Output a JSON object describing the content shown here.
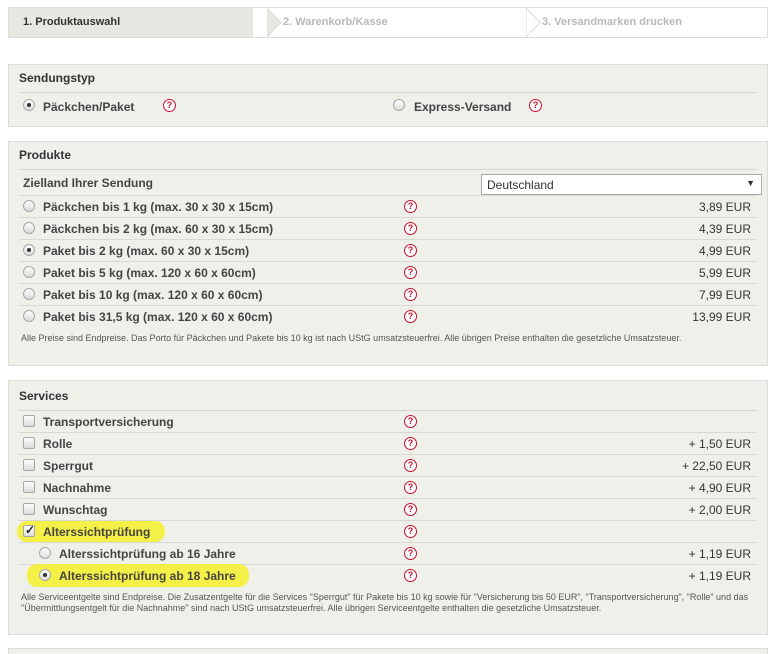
{
  "steps": [
    {
      "label": "1. Produktauswahl"
    },
    {
      "label": "2. Warenkorb/Kasse"
    },
    {
      "label": "3. Versandmarken drucken"
    }
  ],
  "sendungstyp": {
    "title": "Sendungstyp",
    "options": [
      {
        "label": "Päckchen/Paket",
        "selected": true
      },
      {
        "label": "Express-Versand",
        "selected": false
      }
    ]
  },
  "produkte": {
    "title": "Produkte",
    "zielland_label": "Zielland Ihrer Sendung",
    "zielland_value": "Deutschland",
    "items": [
      {
        "label": "Päckchen bis 1 kg (max. 30 x 30 x 15cm)",
        "price": "3,89 EUR",
        "selected": false
      },
      {
        "label": "Päckchen bis 2 kg (max. 60 x 30 x 15cm)",
        "price": "4,39 EUR",
        "selected": false
      },
      {
        "label": "Paket bis 2 kg (max. 60 x 30 x 15cm)",
        "price": "4,99 EUR",
        "selected": true
      },
      {
        "label": "Paket bis 5 kg (max. 120 x 60 x 60cm)",
        "price": "5,99 EUR",
        "selected": false
      },
      {
        "label": "Paket bis 10 kg (max. 120 x 60 x 60cm)",
        "price": "7,99 EUR",
        "selected": false
      },
      {
        "label": "Paket bis 31,5 kg (max. 120 x 60 x 60cm)",
        "price": "13,99 EUR",
        "selected": false
      }
    ],
    "note": "Alle Preise sind Endpreise. Das Porto für Päckchen und Pakete bis 10 kg ist nach UStG umsatzsteuerfrei. Alle übrigen Preise enthalten die gesetzliche Umsatzsteuer."
  },
  "services": {
    "title": "Services",
    "items": [
      {
        "label": "Transportversicherung",
        "price": "",
        "checked": false
      },
      {
        "label": "Rolle",
        "price": "+ 1,50 EUR",
        "checked": false
      },
      {
        "label": "Sperrgut",
        "price": "+ 22,50 EUR",
        "checked": false
      },
      {
        "label": "Nachnahme",
        "price": "+ 4,90 EUR",
        "checked": false
      },
      {
        "label": "Wunschtag",
        "price": "+ 2,00 EUR",
        "checked": false
      },
      {
        "label": "Alterssichtprüfung",
        "price": "",
        "checked": true
      }
    ],
    "sub_items": [
      {
        "label": "Alterssichtprüfung ab 16 Jahre",
        "price": "+ 1,19 EUR",
        "selected": false
      },
      {
        "label": "Alterssichtprüfung ab 18 Jahre",
        "price": "+ 1,19 EUR",
        "selected": true
      }
    ],
    "note": "Alle Serviceentgelte sind Endpreise. Die Zusatzentgelte für die Services \"Sperrgut\" für Pakete bis 10 kg sowie für \"Versicherung bis 50 EUR\", \"Transportversicherung\", \"Rolle\" und das \"Übermittlungsentgelt für die Nachnahme\" sind nach UStG umsatzsteuerfrei. Alle übrigen Serviceentgelte enthalten die gesetzliche Umsatzsteuer."
  },
  "help_symbol": "?",
  "colors": {
    "help": "#c8102e",
    "highlight": "#f4f02a",
    "panel": "#f0f0eb"
  }
}
